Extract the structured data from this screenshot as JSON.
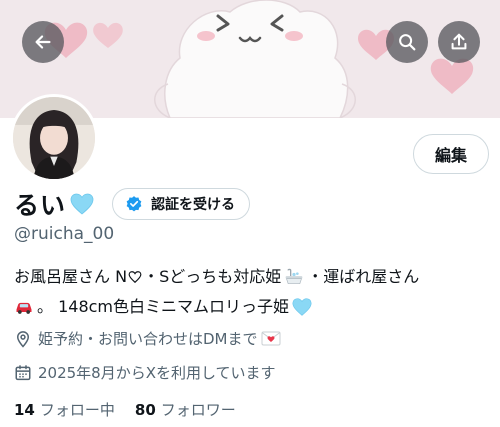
{
  "header": {
    "back_icon": "arrow-left-icon",
    "search_icon": "search-icon",
    "share_icon": "share-icon"
  },
  "profile": {
    "display_name": "るい",
    "name_emoji": "light-blue-heart-emoji",
    "verify_button_label": "認証を受ける",
    "handle": "@ruicha_00",
    "edit_button_label": "編集"
  },
  "bio": {
    "line1_a": "お風呂屋さん N",
    "line1_b": "・Sどっちも対応姫",
    "line1_c": "・運ばれ屋さん",
    "line2_a": "。 148cm色白ミニマムロリっ子姫",
    "emojis": [
      "heart-outline",
      "bathtub-emoji",
      "red-car-emoji",
      "light-blue-heart-emoji"
    ]
  },
  "location": {
    "text": "姫予約・お問い合わせはDMまで",
    "icon": "location-pin-icon"
  },
  "joined": {
    "text": "2025年8月からXを利用しています",
    "icon": "calendar-icon"
  },
  "stats": {
    "following_count": "14",
    "following_label": "フォロー中",
    "followers_count": "80",
    "followers_label": "フォロワー"
  },
  "colors": {
    "accent_blue": "#1d9bf0",
    "heart_blue": "#7fd3f2",
    "secondary_text": "#536471",
    "banner_pink": "#f3e9ec"
  }
}
